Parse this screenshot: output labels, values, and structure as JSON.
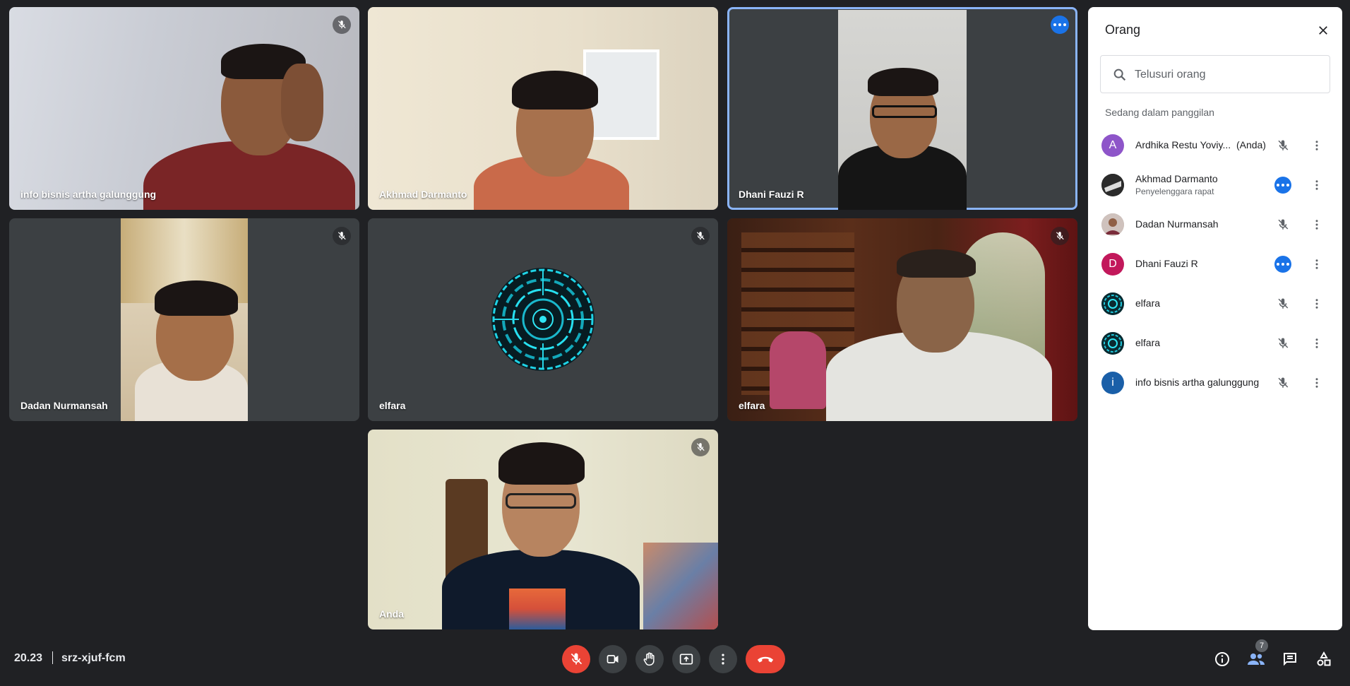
{
  "tiles": [
    {
      "name": "info bisnis artha galunggung",
      "muted": true
    },
    {
      "name": "Akhmad Darmanto",
      "muted": false
    },
    {
      "name": "Dhani Fauzi R",
      "muted": false,
      "speaking_menu": true
    },
    {
      "name": "Dadan Nurmansah",
      "muted": true
    },
    {
      "name": "elfara",
      "muted": true
    },
    {
      "name": "elfara",
      "muted": true
    },
    {
      "name": "Anda",
      "muted": true
    }
  ],
  "meeting": {
    "time": "20.23",
    "code": "srz-xjuf-fcm"
  },
  "people_badge": "7",
  "panel": {
    "title": "Orang",
    "search_placeholder": "Telusuri orang",
    "section": "Sedang dalam panggilan",
    "people": [
      {
        "initial": "A",
        "name": "Ardhika Restu Yoviy...",
        "suffix": "(Anda)",
        "avatar_color": "#8e55c9"
      },
      {
        "initial": "",
        "name": "Akhmad Darmanto",
        "role": "Penyelenggara rapat",
        "avatar_color": "#2b2b2b"
      },
      {
        "initial": "",
        "name": "Dadan Nurmansah",
        "avatar_color": "#b9a9a3"
      },
      {
        "initial": "D",
        "name": "Dhani Fauzi R",
        "avatar_color": "#c2185b"
      },
      {
        "initial": "",
        "name": "elfara",
        "avatar_color": "#0f4a55"
      },
      {
        "initial": "",
        "name": "elfara",
        "avatar_color": "#0f4a55"
      },
      {
        "initial": "i",
        "name": "info bisnis artha galunggung",
        "avatar_color": "#1a5fa8"
      }
    ]
  },
  "icons": {
    "mic_off": "mic-off-icon",
    "camera": "camera-icon",
    "hand": "raise-hand-icon",
    "present": "present-screen-icon",
    "more": "more-vert-icon",
    "hangup": "hang-up-icon",
    "info": "info-icon",
    "people": "people-icon",
    "chat": "chat-icon",
    "activities": "activities-icon"
  }
}
